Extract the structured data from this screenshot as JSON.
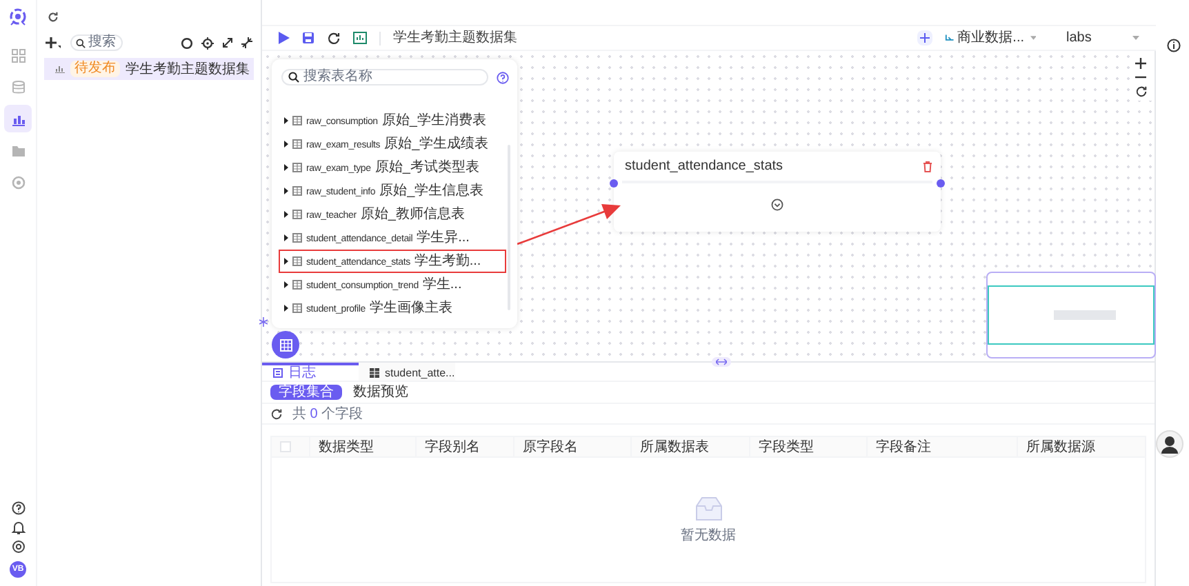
{
  "rail": {
    "items": [
      {
        "kind": "apps",
        "selected": false
      },
      {
        "kind": "database",
        "selected": false
      },
      {
        "kind": "chart",
        "selected": true
      },
      {
        "kind": "folder",
        "selected": false
      },
      {
        "kind": "settings",
        "selected": false
      }
    ],
    "bottom_items": [
      {
        "kind": "help"
      },
      {
        "kind": "bell"
      },
      {
        "kind": "gear"
      }
    ],
    "avatar_initials": "VB"
  },
  "left_panel": {
    "search_placeholder": "搜索",
    "items": [
      {
        "badge": "待发布",
        "label": "学生考勤主题数据集",
        "selected": true
      }
    ]
  },
  "toolbar": {
    "title": "学生考勤主题数据集",
    "datasource": "商业数据...",
    "workspace": "labs"
  },
  "table_list": {
    "search_placeholder": "搜索表名称",
    "tables": [
      {
        "name": "raw_consumption",
        "comment": "原始_学生消费表",
        "highlighted": false
      },
      {
        "name": "raw_exam_results",
        "comment": "原始_学生成绩表",
        "highlighted": false
      },
      {
        "name": "raw_exam_type",
        "comment": "原始_考试类型表",
        "highlighted": false
      },
      {
        "name": "raw_student_info",
        "comment": "原始_学生信息表",
        "highlighted": false
      },
      {
        "name": "raw_teacher",
        "comment": "原始_教师信息表",
        "highlighted": false
      },
      {
        "name": "student_attendance_detail",
        "comment": "学生异...",
        "highlighted": false
      },
      {
        "name": "student_attendance_stats",
        "comment": "学生考勤...",
        "highlighted": true
      },
      {
        "name": "student_consumption_trend",
        "comment": "学生...",
        "highlighted": false
      },
      {
        "name": "student_profile",
        "comment": "学生画像主表",
        "highlighted": false
      }
    ]
  },
  "node": {
    "title": "student_attendance_stats"
  },
  "bottom_panel": {
    "tabs": [
      {
        "label": "日志",
        "kind": "log",
        "selected": true
      },
      {
        "label": "student_atte...",
        "kind": "table",
        "selected": false
      }
    ],
    "subtabs": [
      {
        "label": "字段集合",
        "selected": true
      },
      {
        "label": "数据预览",
        "selected": false
      }
    ],
    "count_prefix": "共",
    "count": "0",
    "count_suffix": "个字段",
    "select_all_checked": false,
    "columns": [
      "数据类型",
      "字段别名",
      "原字段名",
      "所属数据表",
      "字段类型",
      "字段备注",
      "所属数据源"
    ],
    "empty_text": "暂无数据"
  }
}
